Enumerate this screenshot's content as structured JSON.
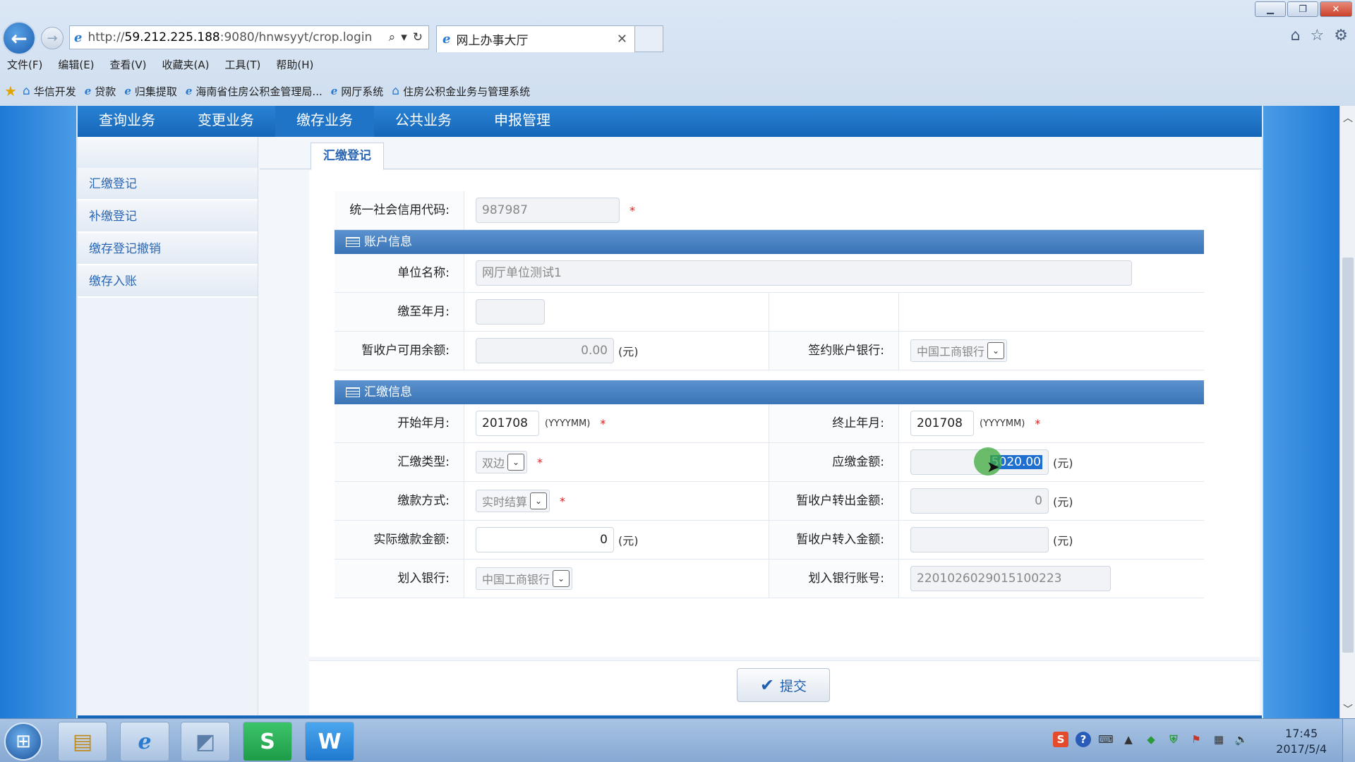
{
  "browser": {
    "url_prefix": "http://",
    "url_host": "59.212.225.188",
    "url_path": ":9080/hnwsyyt/crop.login",
    "tab_title": "网上办事大厅",
    "menu": [
      "文件(F)",
      "编辑(E)",
      "查看(V)",
      "收藏夹(A)",
      "工具(T)",
      "帮助(H)"
    ],
    "favorites": [
      "华信开发",
      "贷款",
      "归集提取",
      "海南省住房公积金管理局...",
      "网厅系统",
      "住房公积金业务与管理系统"
    ]
  },
  "nav": {
    "tabs": [
      "查询业务",
      "变更业务",
      "缴存业务",
      "公共业务",
      "申报管理"
    ],
    "active_index": 2
  },
  "sidebar": {
    "items": [
      "汇缴登记",
      "补缴登记",
      "缴存登记撤销",
      "缴存入账"
    ]
  },
  "page_tab": "汇缴登记",
  "form": {
    "credit_code_label": "统一社会信用代码:",
    "credit_code_value": "987987",
    "account_section": "账户信息",
    "unit_name_label": "单位名称:",
    "unit_name_value": "网厅单位测试1",
    "paid_until_label": "缴至年月:",
    "paid_until_value": "",
    "temp_balance_label": "暂收户可用余额:",
    "temp_balance_value": "0.00",
    "contract_bank_label": "签约账户银行:",
    "contract_bank_value": "中国工商银行",
    "payment_section": "汇缴信息",
    "start_month_label": "开始年月:",
    "start_month_value": "201708",
    "end_month_label": "终止年月:",
    "end_month_value": "201708",
    "month_format": "(YYYYMM)",
    "pay_type_label": "汇缴类型:",
    "pay_type_value": "双边",
    "due_amount_label": "应缴金额:",
    "due_amount_value": "5020.00",
    "pay_method_label": "缴款方式:",
    "pay_method_value": "实时结算",
    "temp_out_label": "暂收户转出金额:",
    "temp_out_value": "0",
    "actual_amount_label": "实际缴款金额:",
    "actual_amount_value": "0",
    "temp_in_label": "暂收户转入金额:",
    "temp_in_value": "",
    "in_bank_label": "划入银行:",
    "in_bank_value": "中国工商银行",
    "in_account_label": "划入银行账号:",
    "in_account_value": "2201026029015100223",
    "yuan": "(元)",
    "required_mark": "*"
  },
  "submit_label": "提交",
  "taskbar": {
    "time": "17:45",
    "date": "2017/5/4"
  },
  "colors": {
    "nav_blue": "#1566b8",
    "required_red": "#e02020",
    "link_blue": "#2a66b4",
    "selection_blue": "#1f6fd1"
  }
}
